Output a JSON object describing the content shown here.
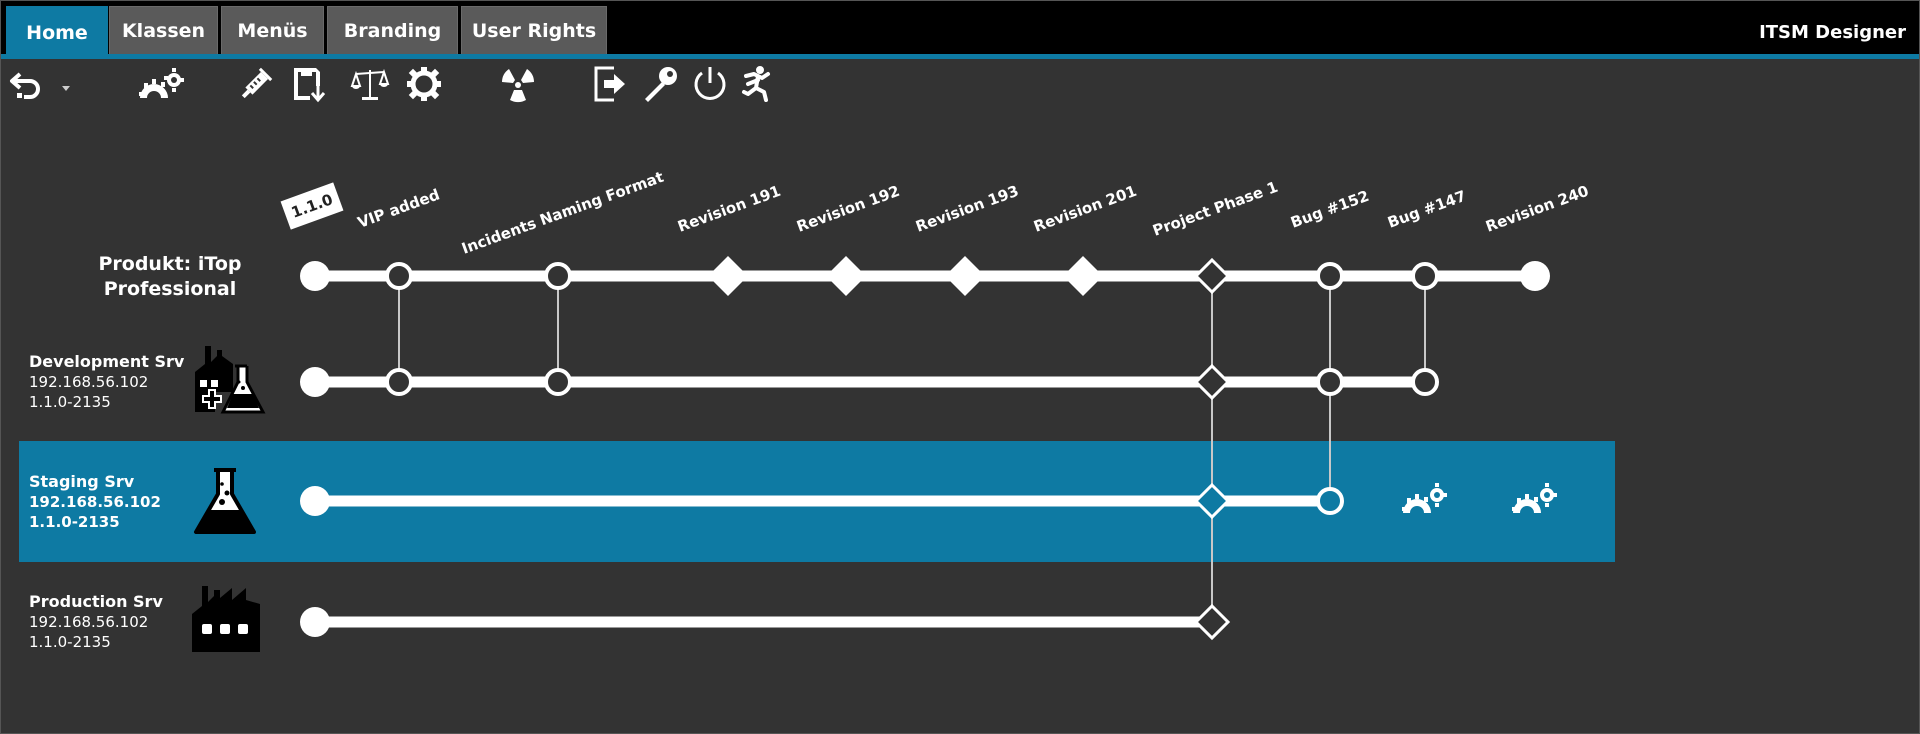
{
  "app_title": "ITSM Designer",
  "tabs": [
    {
      "label": "Home",
      "active": true
    },
    {
      "label": "Klassen",
      "active": false
    },
    {
      "label": "Menüs",
      "active": false
    },
    {
      "label": "Branding",
      "active": false
    },
    {
      "label": "User Rights",
      "active": false
    }
  ],
  "toolbar": [
    {
      "icon": "undo-icon",
      "has_dropdown": true
    },
    {
      "icon": "gears-icon"
    },
    {
      "icon": "syringe-icon"
    },
    {
      "icon": "save-download-icon"
    },
    {
      "icon": "balance-scale-icon"
    },
    {
      "icon": "settings-gear-icon"
    },
    {
      "icon": "radiation-icon"
    },
    {
      "icon": "sign-out-icon"
    },
    {
      "icon": "key-icon"
    },
    {
      "icon": "power-icon"
    },
    {
      "icon": "running-man-icon"
    }
  ],
  "colors": {
    "accent": "#0e7aa3",
    "background": "#333333",
    "header": "#000000",
    "tab_inactive": "#5a5a5a"
  },
  "product": {
    "label": "Produkt: iTop Professional",
    "version_badge": "1.1.0"
  },
  "milestones": [
    {
      "label": "VIP added",
      "shape": "circle"
    },
    {
      "label": "Incidents Naming Format",
      "shape": "circle"
    },
    {
      "label": "Revision 191",
      "shape": "diamond"
    },
    {
      "label": "Revision 192",
      "shape": "diamond"
    },
    {
      "label": "Revision 193",
      "shape": "diamond"
    },
    {
      "label": "Revision 201",
      "shape": "diamond"
    },
    {
      "label": "Project Phase 1",
      "shape": "diamond-open"
    },
    {
      "label": "Bug #152",
      "shape": "circle"
    },
    {
      "label": "Bug #147",
      "shape": "circle"
    },
    {
      "label": "Revision 240",
      "shape": "end"
    }
  ],
  "servers": [
    {
      "name": "Development Srv",
      "ip": "192.168.56.102",
      "version": "1.1.0-2135",
      "icon": "factory-flask-icon",
      "deployed": [
        "VIP added",
        "Incidents Naming Format",
        "Project Phase 1",
        "Bug #152",
        "Bug #147"
      ],
      "selected": false
    },
    {
      "name": "Staging Srv",
      "ip": "192.168.56.102",
      "version": "1.1.0-2135",
      "icon": "flask-icon",
      "deployed": [
        "Project Phase 1",
        "Bug #152"
      ],
      "pending": [
        "Bug #147",
        "Revision 240"
      ],
      "selected": true
    },
    {
      "name": "Production Srv",
      "ip": "192.168.56.102",
      "version": "1.1.0-2135",
      "icon": "factory-icon",
      "deployed": [
        "Project Phase 1"
      ],
      "selected": false
    }
  ]
}
